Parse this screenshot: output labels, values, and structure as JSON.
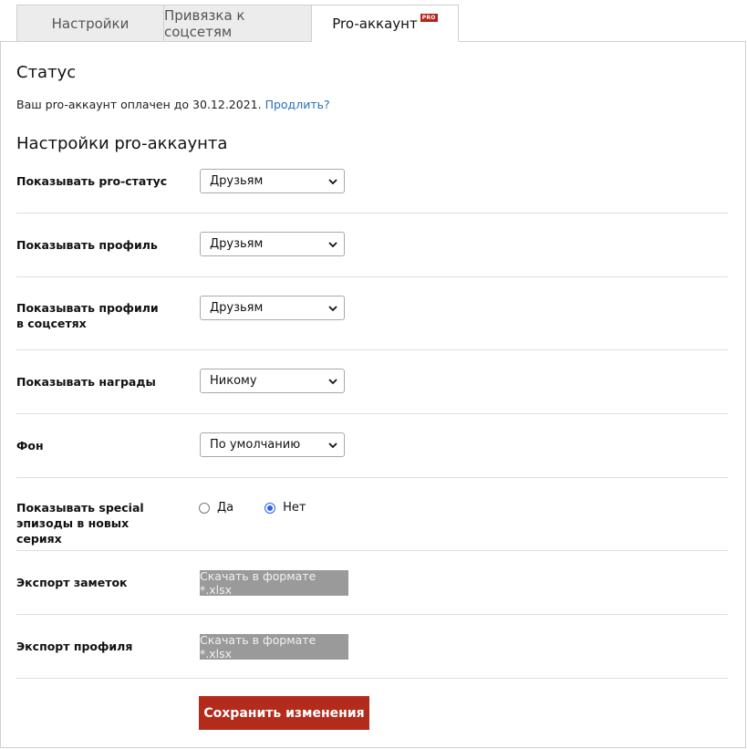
{
  "tabs": [
    {
      "label": "Настройки"
    },
    {
      "label": "Привязка к соцсетям"
    },
    {
      "label": "Pro-аккаунт",
      "badge": "PRO"
    }
  ],
  "status": {
    "title": "Статус",
    "text": "Ваш pro-аккаунт оплачен до 30.12.2021.",
    "link": "Продлить?"
  },
  "settings": {
    "title": "Настройки pro-аккаунта",
    "pro_status": {
      "label": "Показывать pro-статус",
      "value": "Друзьям"
    },
    "profile": {
      "label": "Показывать профиль",
      "value": "Друзьям"
    },
    "social_profiles": {
      "label": "Показывать профили в соцсетях",
      "value": "Друзьям"
    },
    "awards": {
      "label": "Показывать награды",
      "value": "Никому"
    },
    "background": {
      "label": "Фон",
      "value": "По умолчанию"
    },
    "special": {
      "label": "Показывать special эпизоды в новых сериях",
      "options": [
        "Да",
        "Нет"
      ],
      "selected": "Нет"
    },
    "export_notes": {
      "label": "Экспорт заметок",
      "button": "Скачать в формате *.xlsx"
    },
    "export_profile": {
      "label": "Экспорт профиля",
      "button": "Скачать в формате *.xlsx"
    }
  },
  "save_button": "Сохранить изменения",
  "colors": {
    "accent": "#b32b1b",
    "link": "#2a6db8",
    "radio_selected": "#2563eb"
  },
  "icons": {
    "select": "chevron-down-icon"
  }
}
